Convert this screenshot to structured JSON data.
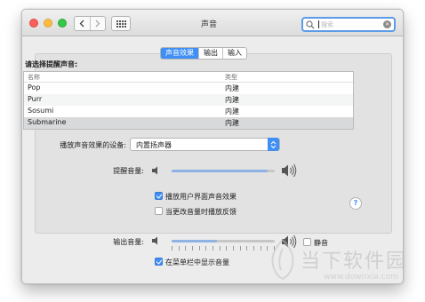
{
  "window": {
    "title": "声音"
  },
  "search": {
    "placeholder": "搜索"
  },
  "tabs": [
    {
      "label": "声音效果",
      "active": true
    },
    {
      "label": "输出",
      "active": false
    },
    {
      "label": "输入",
      "active": false
    }
  ],
  "alert": {
    "select_label": "请选择提醒声音:",
    "columns": [
      "名称",
      "类型"
    ],
    "rows": [
      {
        "name": "Pop",
        "type": "内建"
      },
      {
        "name": "Purr",
        "type": "内建"
      },
      {
        "name": "Sosumi",
        "type": "内建"
      },
      {
        "name": "Submarine",
        "type": "内建",
        "selected": true
      }
    ]
  },
  "device": {
    "label": "播放声音效果的设备:",
    "value": "内置扬声器"
  },
  "alert_volume": {
    "label": "提醒音量:",
    "level": 0.93
  },
  "options": [
    {
      "label": "播放用户界面声音效果",
      "checked": true
    },
    {
      "label": "当更改音量时播放反馈",
      "checked": false
    }
  ],
  "help": {
    "label": "?"
  },
  "output_volume": {
    "label": "输出音量:",
    "level": 0.44,
    "mute_label": "静音",
    "mute_checked": false
  },
  "menubar_option": {
    "label": "在菜单栏中显示音量",
    "checked": true
  },
  "watermark": {
    "text": "当下软件园",
    "url": "www.downxia.com"
  },
  "colors": {
    "accent": "#3f8ff5",
    "window_bg": "#ececec",
    "selected_row": "#d7d9db"
  },
  "icons": [
    "back-arrow-icon",
    "forward-arrow-icon",
    "grid-icon",
    "search-icon",
    "clear-icon",
    "popup-arrows-icon",
    "speaker-low-icon",
    "speaker-high-icon",
    "help-icon"
  ]
}
